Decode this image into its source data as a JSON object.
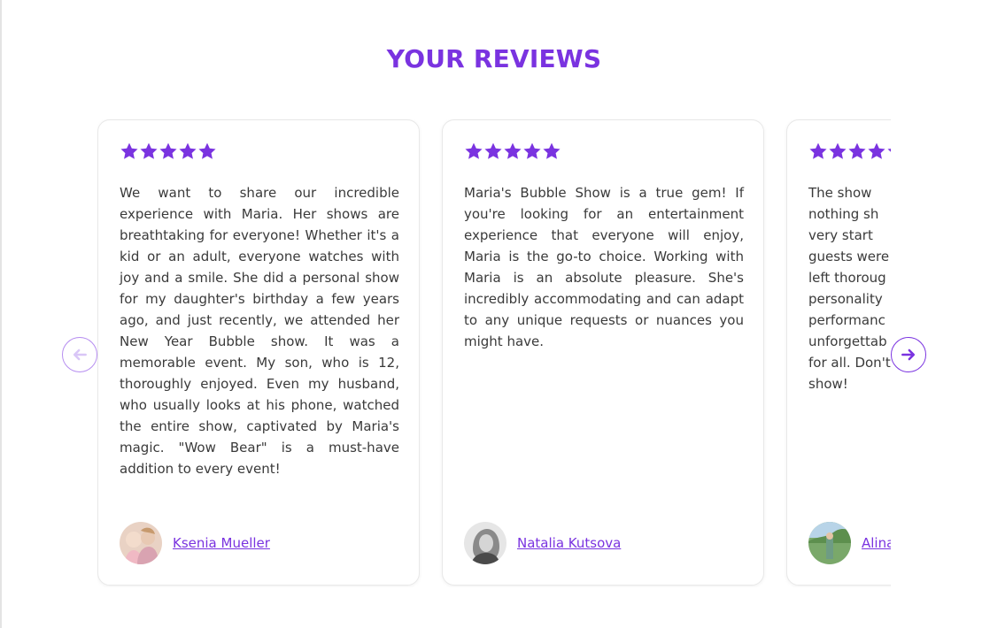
{
  "heading": "YOUR REVIEWS",
  "colors": {
    "accent": "#7a33e0",
    "star": "#7a33e0",
    "nav_disabled": "#d9c6f7"
  },
  "nav": {
    "prev_icon": "arrow-left-icon",
    "next_icon": "arrow-right-icon"
  },
  "reviews": [
    {
      "rating": 5,
      "text": "We want to share our incredible experience with Maria. Her shows are breathtaking for everyone! Whether it's a kid or an adult, everyone watches with joy and a smile. She did a personal show for my daughter's birthday a few years ago, and just recently, we attended her New Year Bubble show. It was a memorable event. My son, who is 12, thoroughly enjoyed. Even my husband, who usually looks at his phone, watched the entire show, captivated by Maria's magic. \"Wow Bear\" is a must-have addition to every event!",
      "author": "Ksenia Mueller"
    },
    {
      "rating": 5,
      "text": "Maria's Bubble Show is a true gem! If you're looking for an entertainment experience that everyone will enjoy, Maria is the go-to choice. Working with Maria is an absolute pleasure. She's incredibly accommodating and can adapt to any unique requests or nuances you might have.",
      "author": "Natalia Kutsova"
    },
    {
      "rating": 5,
      "text": "The show nothing sh very start guests were left thoroug personality performanc unforgettab for all. Don't show!",
      "author": "Alina"
    }
  ]
}
